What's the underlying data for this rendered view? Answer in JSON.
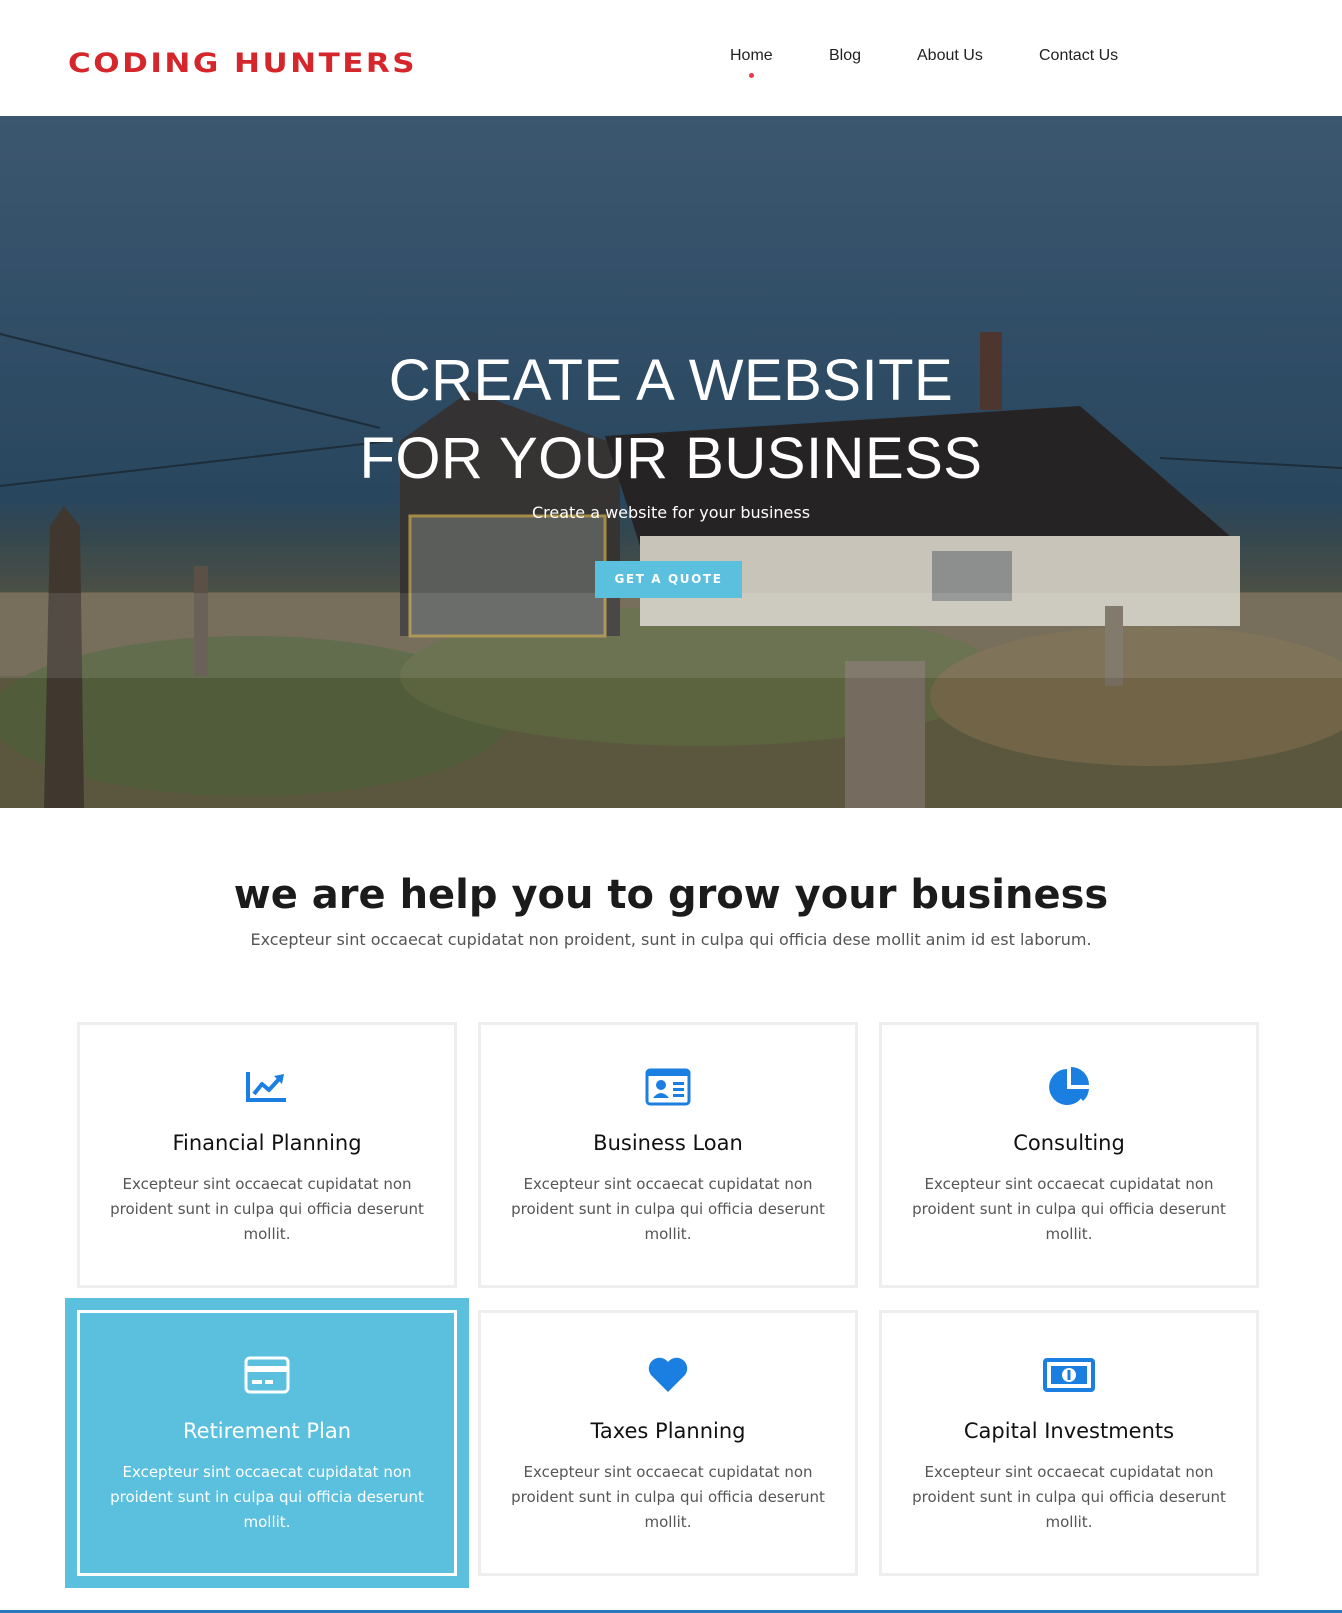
{
  "header": {
    "logo": "CODING HUNTERS",
    "nav": [
      {
        "label": "Home",
        "active": true
      },
      {
        "label": "Blog",
        "active": false
      },
      {
        "label": "About Us",
        "active": false
      },
      {
        "label": "Contact Us",
        "active": false
      }
    ]
  },
  "hero": {
    "title_line1": "CREATE A WEBSITE",
    "title_line2": "FOR YOUR BUSINESS",
    "subtitle": "Create a website for your business",
    "button": "GET A QUOTE"
  },
  "section": {
    "title": "we are help you to grow your business",
    "subtitle": "Excepteur sint occaecat cupidatat non proident, sunt in culpa qui officia dese mollit anim id est laborum."
  },
  "services": [
    {
      "icon": "chart-line-icon",
      "title": "Financial Planning",
      "text": "Excepteur sint occaecat cupidatat non proident sunt in culpa qui officia deserunt mollit."
    },
    {
      "icon": "id-card-icon",
      "title": "Business Loan",
      "text": "Excepteur sint occaecat cupidatat non proident sunt in culpa qui officia deserunt mollit."
    },
    {
      "icon": "pie-chart-icon",
      "title": "Consulting",
      "text": "Excepteur sint occaecat cupidatat non proident sunt in culpa qui officia deserunt mollit."
    },
    {
      "icon": "credit-card-icon",
      "title": "Retirement Plan",
      "text": "Excepteur sint occaecat cupidatat non proident sunt in culpa qui officia deserunt mollit.",
      "active": true
    },
    {
      "icon": "heart-icon",
      "title": "Taxes Planning",
      "text": "Excepteur sint occaecat cupidatat non proident sunt in culpa qui officia deserunt mollit."
    },
    {
      "icon": "money-bill-icon",
      "title": "Capital Investments",
      "text": "Excepteur sint occaecat cupidatat non proident sunt in culpa qui officia deserunt mollit."
    }
  ],
  "colors": {
    "brand": "#d4262b",
    "accent": "#5bc0de",
    "icon": "#1a7fe0",
    "nav_dot": "#e8384b"
  }
}
